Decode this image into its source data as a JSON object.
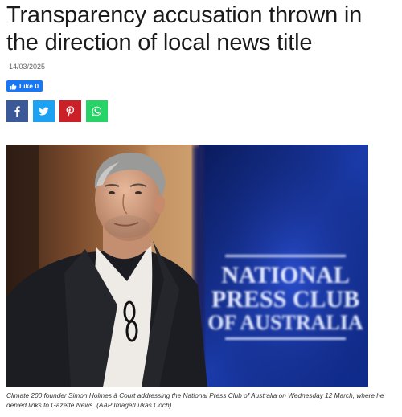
{
  "article": {
    "title": "Transparency accusation thrown in the direction of local news title",
    "date": "14/03/2025",
    "caption": "Climate 200 founder Simon Holmes à Court addressing the National Press Club of Australia on Wednesday 12 March, where he denied links to Gazette News. (AAP Image/Lukas Coch)"
  },
  "social": {
    "like_label": "Like 0",
    "share_buttons": [
      {
        "icon": "facebook-icon",
        "color": "#3b5998"
      },
      {
        "icon": "twitter-icon",
        "color": "#1da1f2"
      },
      {
        "icon": "pinterest-icon",
        "color": "#cb2027"
      },
      {
        "icon": "whatsapp-icon",
        "color": "#25d366"
      }
    ]
  },
  "photo": {
    "sign_lines": [
      "NATIONAL",
      "PRESS CLUB",
      "OF AUSTRALIA"
    ]
  }
}
